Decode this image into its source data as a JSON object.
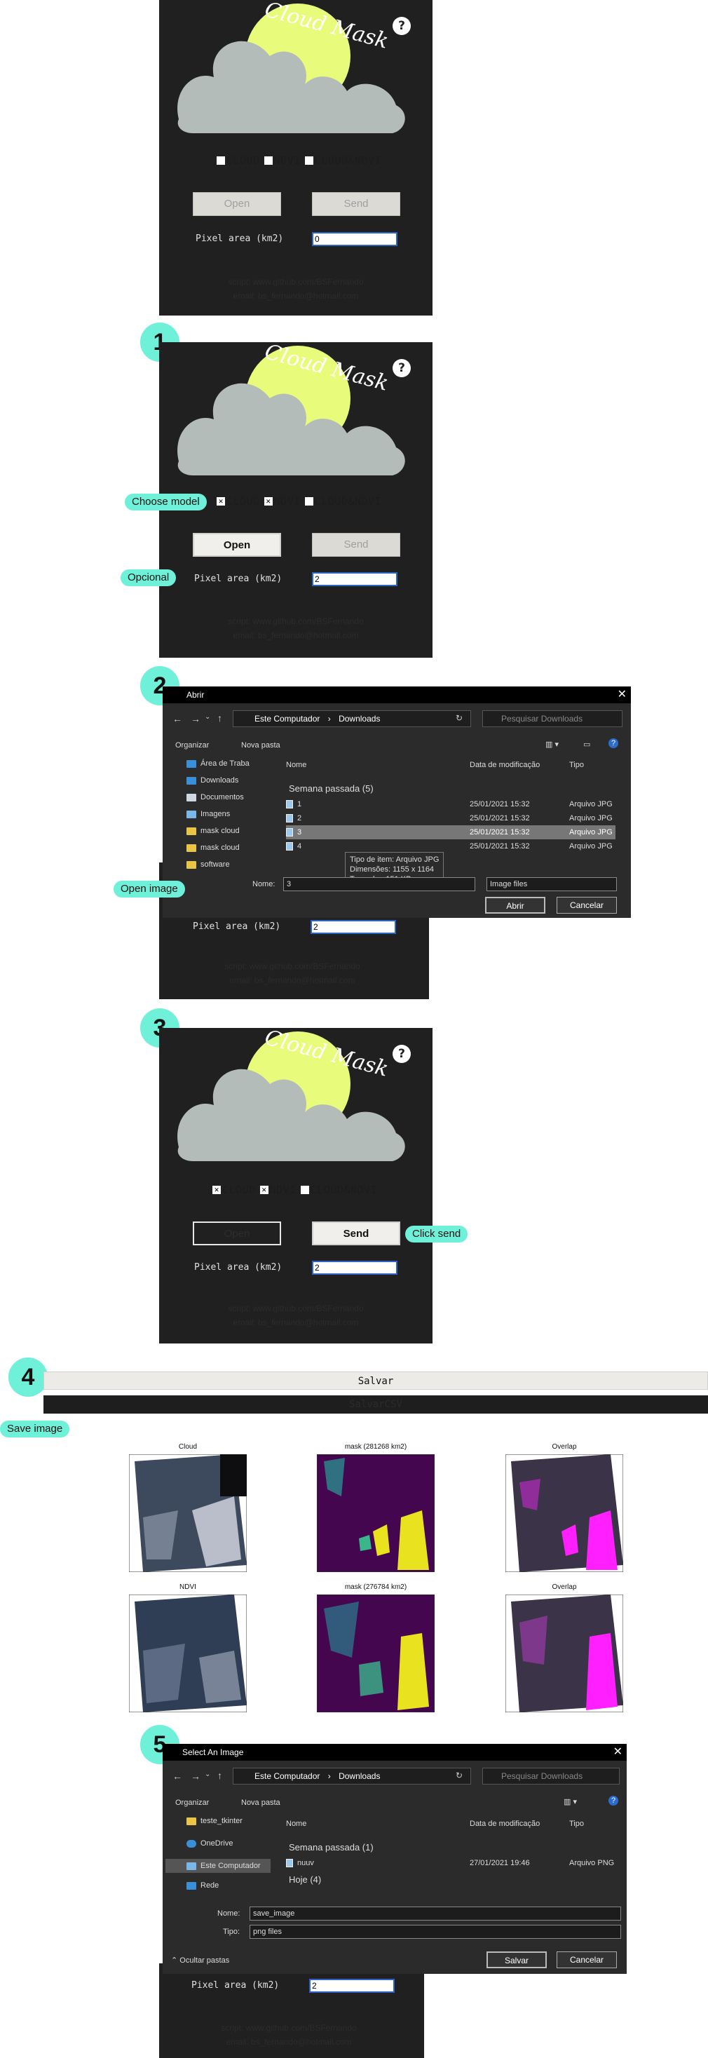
{
  "logo": {
    "text": "Cloud Mask"
  },
  "help": {
    "label": "?"
  },
  "app_panels": [
    {
      "checkboxes": [
        {
          "label": "CLOUD",
          "checked": false
        },
        {
          "label": "NDVI",
          "checked": false
        },
        {
          "label": "CLOUD&NDVI",
          "checked": false
        }
      ],
      "open_label": "Open",
      "send_label": "Send",
      "pixel_label": "Pixel area (km2)",
      "pixel_value": "0",
      "credit_1": "script: www.github.com/BSFernando",
      "credit_2": "email: bs_fernando@hotmail.com"
    },
    {
      "checkboxes": [
        {
          "label": "CLOUD",
          "checked": true
        },
        {
          "label": "NDVI",
          "checked": true
        },
        {
          "label": "CLOUD&NDVI",
          "checked": false
        }
      ],
      "open_label": "Open",
      "send_label": "Send",
      "pixel_label": "Pixel area (km2)",
      "pixel_value": "2",
      "credit_1": "script: www.github.com/BSFernando",
      "credit_2": "email: bs_fernando@hotmail.com"
    },
    {
      "pixel_label": "Pixel area (km2)",
      "pixel_value": "2",
      "credit_1": "script: www.github.com/BSFernando",
      "credit_2": "email: bs_fernando@hotmail.com"
    },
    {
      "checkboxes": [
        {
          "label": "CLOUD",
          "checked": true
        },
        {
          "label": "NDVI",
          "checked": true
        },
        {
          "label": "CLOUD&NDVI",
          "checked": false
        }
      ],
      "open_label": "Open",
      "send_label": "Send",
      "pixel_label": "Pixel area (km2)",
      "pixel_value": "2",
      "credit_1": "script: www.github.com/BSFernando",
      "credit_2": "email: bs_fernando@hotmail.com"
    },
    {
      "pixel_label": "Pixel area (km2)",
      "pixel_value": "2",
      "credit_1": "script: www.github.com/BSFernando",
      "credit_2": "email: bs_fernando@hotmail.com"
    }
  ],
  "steps": [
    "1",
    "2",
    "3",
    "4",
    "5"
  ],
  "tags": {
    "choose_model": "Choose model",
    "opcional": "Opcional",
    "open_image": "Open image",
    "click_send": "Click send",
    "save_image": "Save image"
  },
  "open_dialog": {
    "title": "Abrir",
    "path_root": "Este Computador",
    "path_folder": "Downloads",
    "search_placeholder": "Pesquisar Downloads",
    "organize": "Organizar",
    "new_folder": "Nova pasta",
    "sidebar": [
      "Área de Traba",
      "Downloads",
      "Documentos",
      "Imagens",
      "mask cloud",
      "mask cloud",
      "software"
    ],
    "columns": [
      "Nome",
      "Data de modificação",
      "Tipo"
    ],
    "group": "Semana passada (5)",
    "rows": [
      {
        "name": "1",
        "date": "25/01/2021 15:32",
        "type": "Arquivo JPG"
      },
      {
        "name": "2",
        "date": "25/01/2021 15:32",
        "type": "Arquivo JPG"
      },
      {
        "name": "3",
        "date": "25/01/2021 15:32",
        "type": "Arquivo JPG"
      },
      {
        "name": "4",
        "date": "25/01/2021 15:32",
        "type": "Arquivo JPG"
      }
    ],
    "tooltip": [
      "Tipo de item: Arquivo JPG",
      "Dimensões: 1155 x 1164",
      "Tamanho: 151 KB"
    ],
    "name_label": "Nome:",
    "name_value": "3",
    "filter": "Image files",
    "ok": "Abrir",
    "cancel": "Cancelar"
  },
  "save_bar": {
    "save": "Salvar",
    "save_csv": "SalvarCSV"
  },
  "plots": {
    "titles": [
      "Cloud",
      "mask (281268 km2)",
      "Overlap",
      "NDVI",
      "mask (276784 km2)",
      "Overlap"
    ]
  },
  "save_dialog": {
    "title": "Select An Image",
    "path_root": "Este Computador",
    "path_folder": "Downloads",
    "search_placeholder": "Pesquisar Downloads",
    "organize": "Organizar",
    "new_folder": "Nova pasta",
    "sidebar": [
      "teste_tkinter",
      "OneDrive",
      "Este Computador",
      "Rede"
    ],
    "columns": [
      "Nome",
      "Data de modificação",
      "Tipo"
    ],
    "group": "Semana passada (1)",
    "rows": [
      {
        "name": "nuuv",
        "date": "27/01/2021 19:46",
        "type": "Arquivo PNG"
      }
    ],
    "group2": "Hoje (4)",
    "name_label": "Nome:",
    "name_value": "save_image",
    "type_label": "Tipo:",
    "type_value": "png files",
    "hide_folders": "Ocultar pastas",
    "ok": "Salvar",
    "cancel": "Cancelar"
  }
}
